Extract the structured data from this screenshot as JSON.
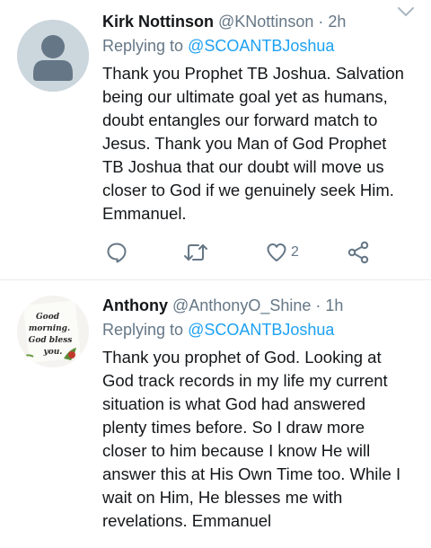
{
  "tweets": [
    {
      "name": "Kirk Nottinson",
      "handle": "@KNottinson",
      "separator": "·",
      "time": "2h",
      "replying_label": "Replying to",
      "replying_to": "@SCOANTBJoshua",
      "body_lines": [
        "Thank you Prophet TB Joshua. Salvation",
        "being our ultimate goal yet as humans,",
        "doubt entangles our forward match to",
        "Jesus. Thank you Man of God Prophet",
        "TB Joshua that our doubt will move us",
        "closer to God if we genuinely seek Him.",
        "Emmanuel."
      ],
      "avatar": "default-avatar-icon",
      "like_count": "2"
    },
    {
      "name": "Anthony",
      "handle": "@AnthonyO_Shine",
      "separator": "·",
      "time": "1h",
      "replying_label": "Replying to",
      "replying_to": "@SCOANTBJoshua",
      "body_lines": [
        "Thank you prophet of God. Looking at",
        "God track records in my life my current",
        "situation is what God had answered",
        "plenty times before. So I draw more",
        "closer to him because I know He will",
        "answer this at His Own Time too. While I",
        "wait on Him, He blesses me with",
        "revelations. Emmanuel"
      ],
      "avatar": "good-morning-card-avatar",
      "avatar_text": [
        "Good",
        "morning.",
        "God bless",
        "you."
      ]
    }
  ],
  "colors": {
    "text": "#14171a",
    "secondary": "#657786",
    "link": "#1da1f2",
    "divider": "#e6ecf0",
    "avatar_default": "#ccd6dd"
  }
}
